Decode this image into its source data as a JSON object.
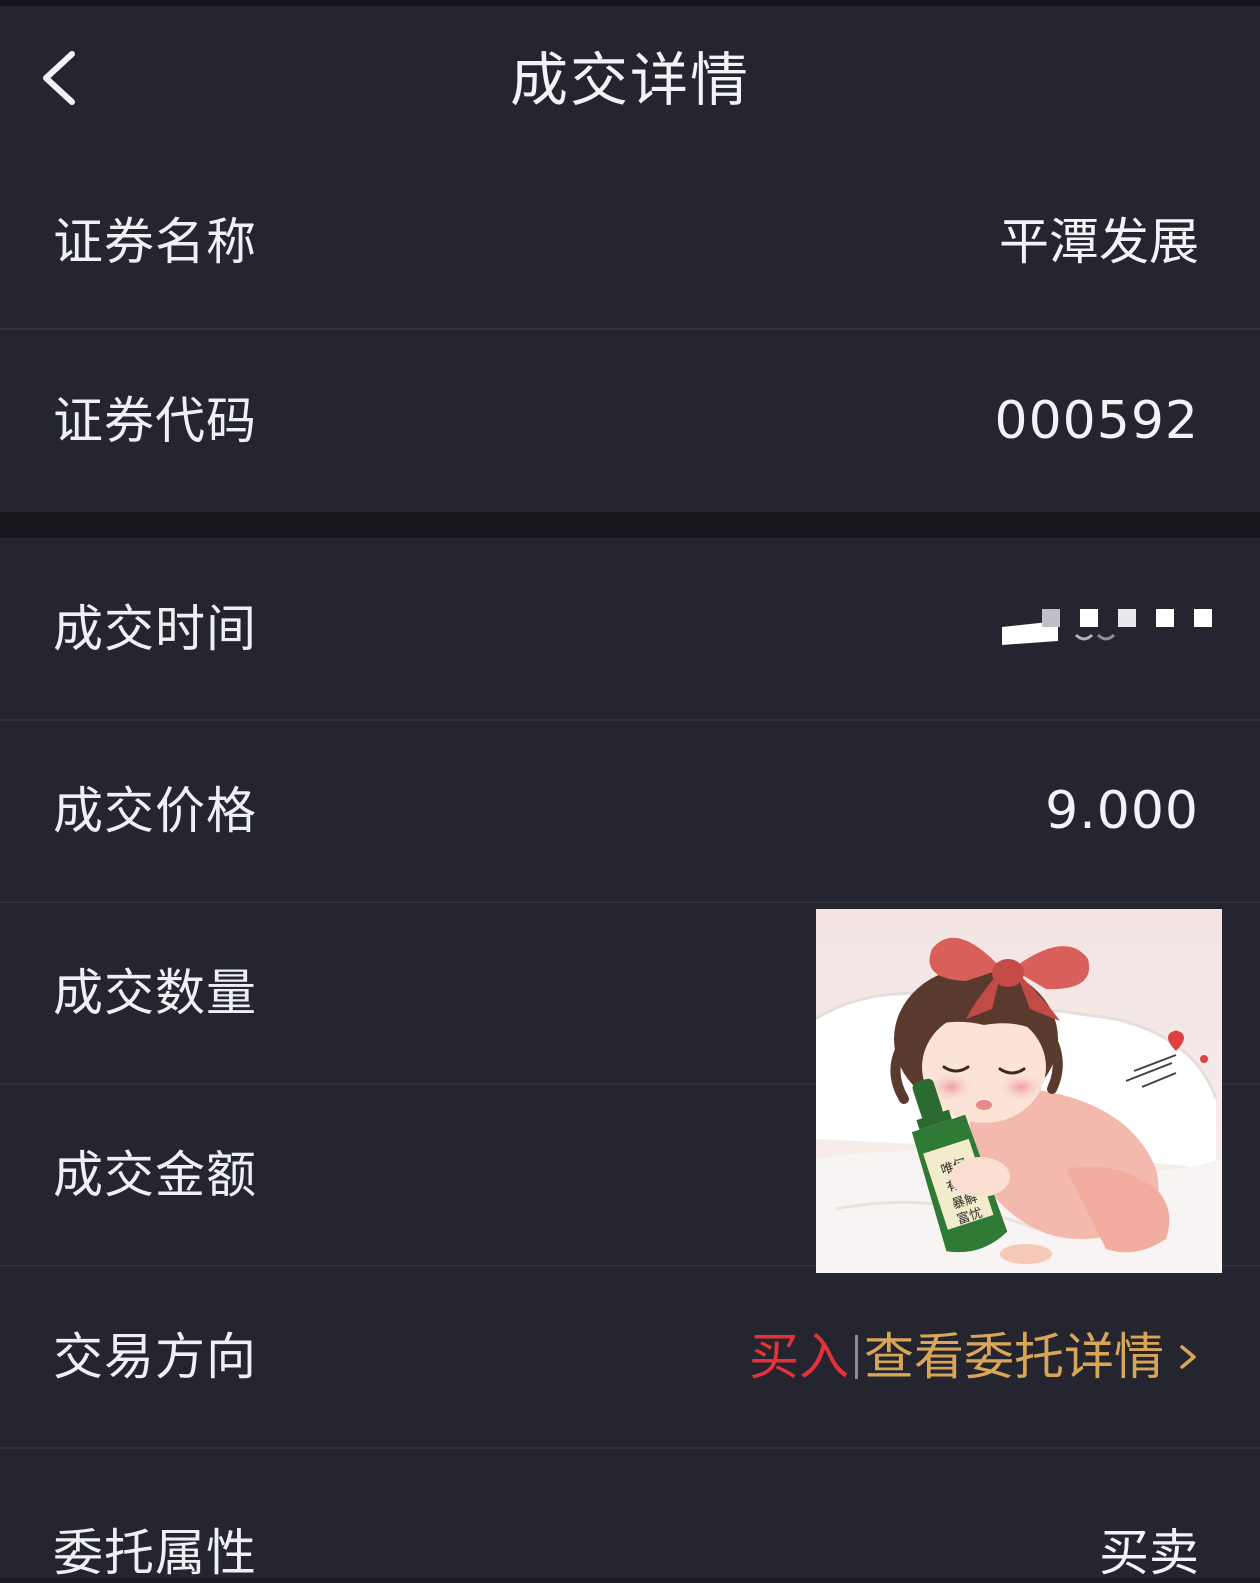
{
  "header": {
    "title": "成交详情"
  },
  "security": {
    "name_label": "证券名称",
    "name_value": "平潭发展",
    "code_label": "证券代码",
    "code_value": "000592"
  },
  "trade": {
    "time_label": "成交时间",
    "price_label": "成交价格",
    "price_value": "9.000",
    "quantity_label": "成交数量",
    "amount_label": "成交金额",
    "direction_label": "交易方向",
    "direction_value": "买入",
    "order_link": "查看委托详情",
    "attribute_label": "委托属性",
    "attribute_value": "买卖"
  },
  "colors": {
    "background": "#1b1c22",
    "card": "#24252f",
    "buy": "#e5323a",
    "link": "#d8a659"
  },
  "icons": [
    "back-arrow-icon",
    "chevron-right-icon"
  ],
  "overlay_sticker_bottle_text": "何以解忧 唯有暴富"
}
